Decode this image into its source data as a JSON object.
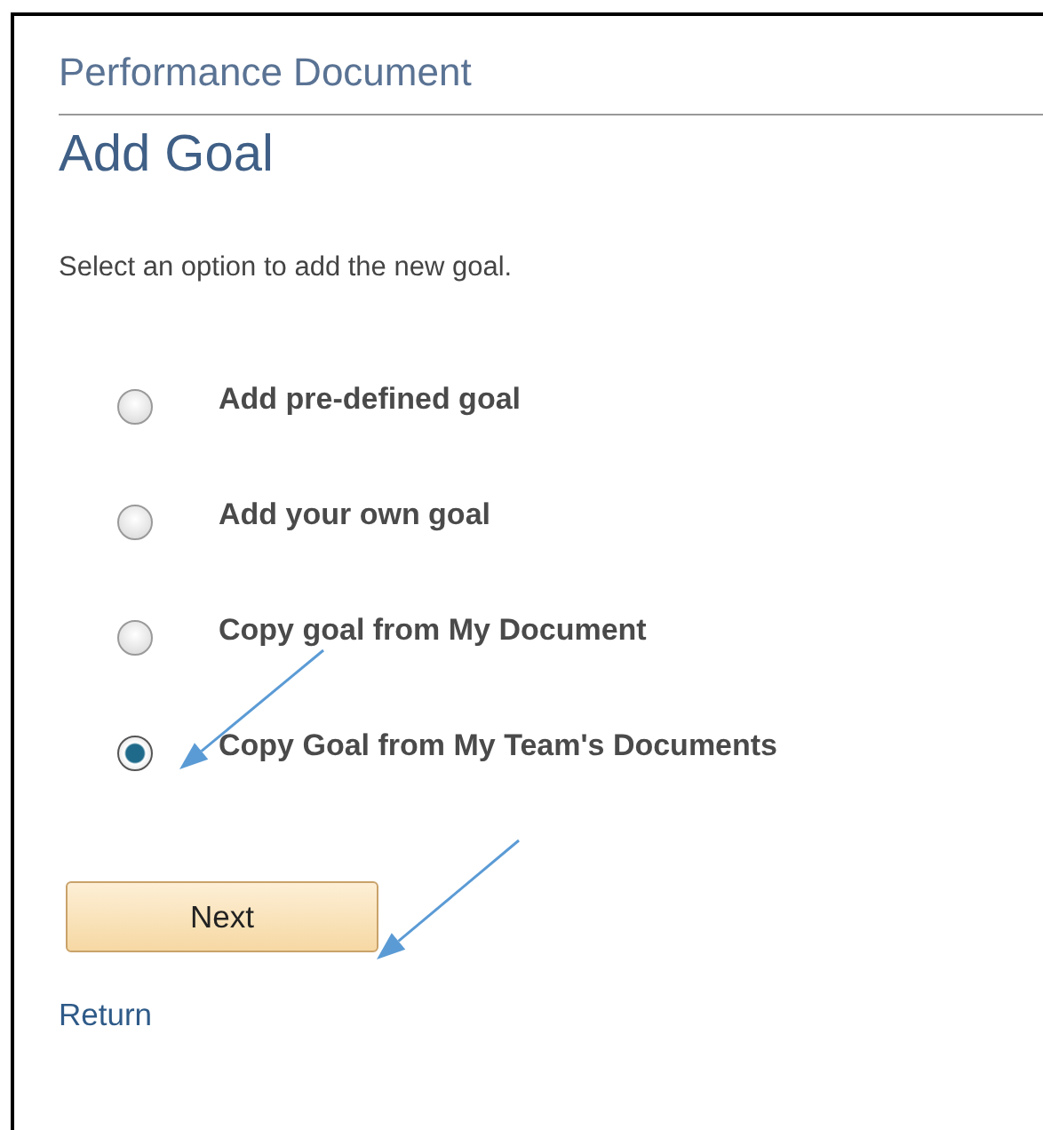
{
  "page": {
    "section_title": "Performance Document",
    "title": "Add Goal"
  },
  "instruction": "Select an option to add the new goal.",
  "options": [
    {
      "label": "Add pre-defined goal",
      "selected": false
    },
    {
      "label": "Add your own goal",
      "selected": false
    },
    {
      "label": "Copy goal from My Document",
      "selected": false
    },
    {
      "label": "Copy Goal from My Team's Documents",
      "selected": true
    }
  ],
  "buttons": [
    {
      "label": "Next"
    }
  ],
  "links": [
    {
      "label": "Return"
    }
  ]
}
